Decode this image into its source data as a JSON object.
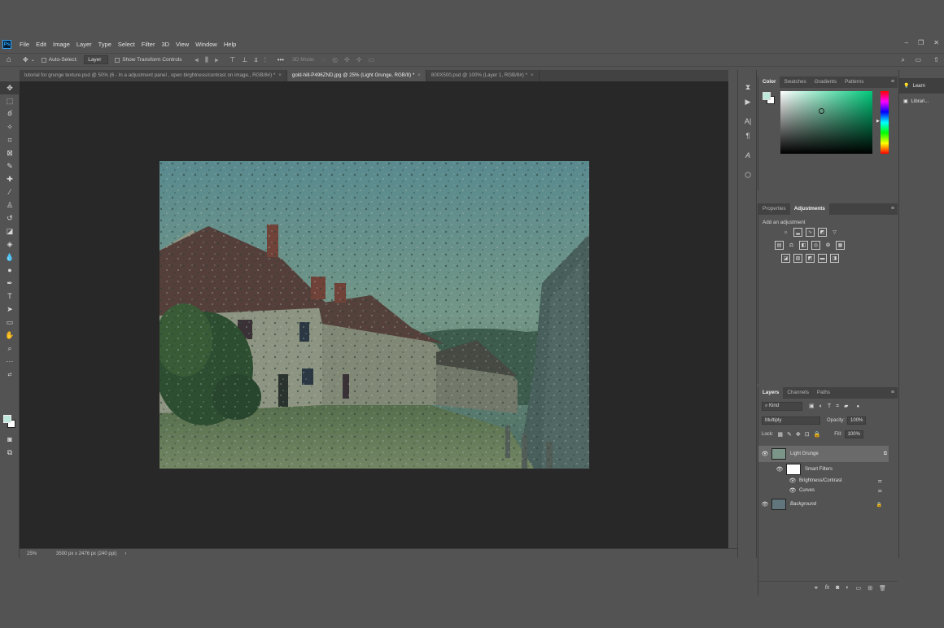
{
  "menubar": {
    "logo": "Ps",
    "items": [
      "File",
      "Edit",
      "Image",
      "Layer",
      "Type",
      "Select",
      "Filter",
      "3D",
      "View",
      "Window",
      "Help"
    ]
  },
  "options": {
    "auto_select_label": "Auto-Select:",
    "layer_dropdown": "Layer",
    "show_transform_label": "Show Transform Controls",
    "mode_3d_label": "3D Mode:"
  },
  "tabs": [
    {
      "label": "tutorial for grunge texture.psd @ 50% (6 - In a adjustment panel , open birghtness/contrast on image., RGB/8#) *",
      "active": false
    },
    {
      "label": "gold-hill-P496ZND.jpg @ 25% (Light Grunge, RGB/8) *",
      "active": true
    },
    {
      "label": "800X500.psd @ 100% (Layer 1, RGB/8#) *",
      "active": false
    }
  ],
  "status": {
    "zoom": "25%",
    "doc_info": "3500 px x 2476 px (240 ppi)"
  },
  "color_panel": {
    "tabs": [
      "Color",
      "Swatches",
      "Gradients",
      "Patterns"
    ],
    "foreground": "#bfe8dc",
    "background": "#ffffff",
    "picker_hue": "#00c87a"
  },
  "adjustments_panel": {
    "tabs": [
      "Properties",
      "Adjustments"
    ],
    "add_label": "Add an adjustment"
  },
  "layers_panel": {
    "tabs": [
      "Layers",
      "Channels",
      "Paths"
    ],
    "filter_kind": "Kind",
    "blend_mode": "Multiply",
    "opacity_label": "Opacity:",
    "opacity_value": "100%",
    "lock_label": "Lock:",
    "fill_label": "Fill:",
    "fill_value": "100%",
    "layers": {
      "light_grunge": "Light Grunge",
      "smart_filters": "Smart Filters",
      "brightness": "Brightness/Contrast",
      "curves": "Curves",
      "background": "Background"
    }
  },
  "right_panel": {
    "learn": "Learn",
    "libraries": "Librari..."
  }
}
